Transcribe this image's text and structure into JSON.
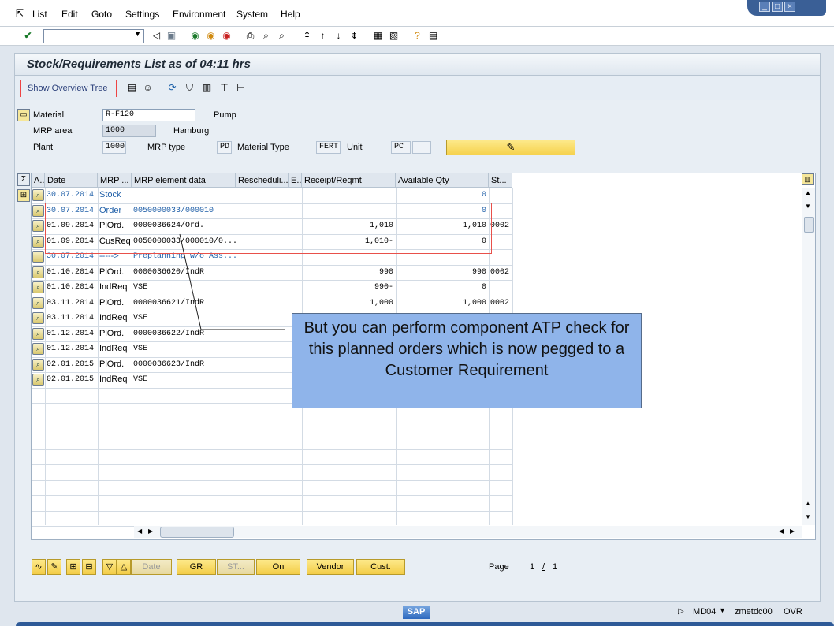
{
  "menu": [
    "List",
    "Edit",
    "Goto",
    "Settings",
    "Environment",
    "System",
    "Help"
  ],
  "title": "Stock/Requirements List as of 04:11 hrs",
  "app_toolbar": {
    "show_tree": "Show Overview Tree"
  },
  "header": {
    "material_label": "Material",
    "material_value": "R-F120",
    "material_desc": "Pump",
    "mrp_area_label": "MRP area",
    "mrp_area_value": "1000",
    "mrp_area_desc": "Hamburg",
    "plant_label": "Plant",
    "plant_value": "1000",
    "mrp_type_label": "MRP type",
    "mrp_type_value": "PD",
    "material_type_label": "Material Type",
    "material_type_value": "FERT",
    "unit_label": "Unit",
    "unit_value": "PC"
  },
  "grid": {
    "columns": [
      "A...",
      "Date",
      "MRP ...",
      "MRP element data",
      "Rescheduli...",
      "E...",
      "Receipt/Reqmt",
      "Available Qty",
      "St..."
    ],
    "rows": [
      {
        "date": "30.07.2014",
        "elem": "Stock",
        "data": "",
        "receipt": "",
        "avail": "0",
        "st": "",
        "blue": true
      },
      {
        "date": "30.07.2014",
        "elem": "Order",
        "data": "0050000033/000010",
        "receipt": "",
        "avail": "0",
        "st": "",
        "blue": true
      },
      {
        "date": "01.09.2014",
        "elem": "PlOrd.",
        "data": "0000036624/Ord.",
        "receipt": "1,010",
        "avail": "1,010",
        "st": "0002",
        "blue": false
      },
      {
        "date": "01.09.2014",
        "elem": "CusReq",
        "data": "0050000033/000010/0...",
        "receipt": "1,010-",
        "avail": "0",
        "st": "",
        "blue": false
      },
      {
        "date": "30.07.2014",
        "elem": "----->",
        "data": "Preplanning w/o Ass...",
        "receipt": "",
        "avail": "",
        "st": "",
        "blue": true
      },
      {
        "date": "01.10.2014",
        "elem": "PlOrd.",
        "data": "0000036620/IndR",
        "receipt": "990",
        "avail": "990",
        "st": "0002",
        "blue": false
      },
      {
        "date": "01.10.2014",
        "elem": "IndReq",
        "data": "VSE",
        "receipt": "990-",
        "avail": "0",
        "st": "",
        "blue": false
      },
      {
        "date": "03.11.2014",
        "elem": "PlOrd.",
        "data": "0000036621/IndR",
        "receipt": "1,000",
        "avail": "1,000",
        "st": "0002",
        "blue": false
      },
      {
        "date": "03.11.2014",
        "elem": "IndReq",
        "data": "VSE",
        "receipt": "",
        "avail": "",
        "st": "",
        "blue": false
      },
      {
        "date": "01.12.2014",
        "elem": "PlOrd.",
        "data": "0000036622/IndR",
        "receipt": "",
        "avail": "",
        "st": "",
        "blue": false
      },
      {
        "date": "01.12.2014",
        "elem": "IndReq",
        "data": "VSE",
        "receipt": "",
        "avail": "",
        "st": "",
        "blue": false
      },
      {
        "date": "02.01.2015",
        "elem": "PlOrd.",
        "data": "0000036623/IndR",
        "receipt": "",
        "avail": "",
        "st": "",
        "blue": false
      },
      {
        "date": "02.01.2015",
        "elem": "IndReq",
        "data": "VSE",
        "receipt": "",
        "avail": "",
        "st": "",
        "blue": false
      }
    ]
  },
  "callout": "But you can perform component ATP check for this planned orders which is now pegged to a Customer Requirement",
  "bottom_buttons": {
    "date": "Date",
    "gr": "GR",
    "st": "ST...",
    "on": "On",
    "vendor": "Vendor",
    "cust": "Cust."
  },
  "paging": {
    "label": "Page",
    "current": "1",
    "sep": "/",
    "total": "1"
  },
  "status": {
    "logo": "SAP",
    "tcode": "MD04",
    "server": "zmetdc00",
    "mode": "OVR"
  }
}
